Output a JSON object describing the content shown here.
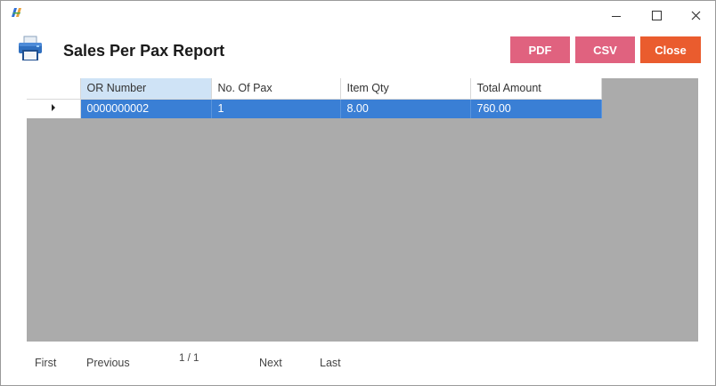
{
  "window": {
    "logo_icon": "app-logo-icon"
  },
  "header": {
    "title": "Sales Per Pax Report",
    "icon": "printer-icon",
    "buttons": {
      "pdf": "PDF",
      "csv": "CSV",
      "close": "Close"
    },
    "colors": {
      "pdf": "#e0627f",
      "csv": "#e0627f",
      "close": "#ea5c2e"
    }
  },
  "grid": {
    "columns": [
      "OR Number",
      "No. Of Pax",
      "Item Qty",
      "Total Amount"
    ],
    "rows": [
      {
        "or_number": "0000000002",
        "pax": "1",
        "qty": "8.00",
        "total": "760.00",
        "selected": true
      }
    ],
    "selection_color": "#3a7fd5"
  },
  "pager": {
    "first": "First",
    "previous": "Previous",
    "page_info": "1 / 1",
    "next": "Next",
    "last": "Last"
  }
}
